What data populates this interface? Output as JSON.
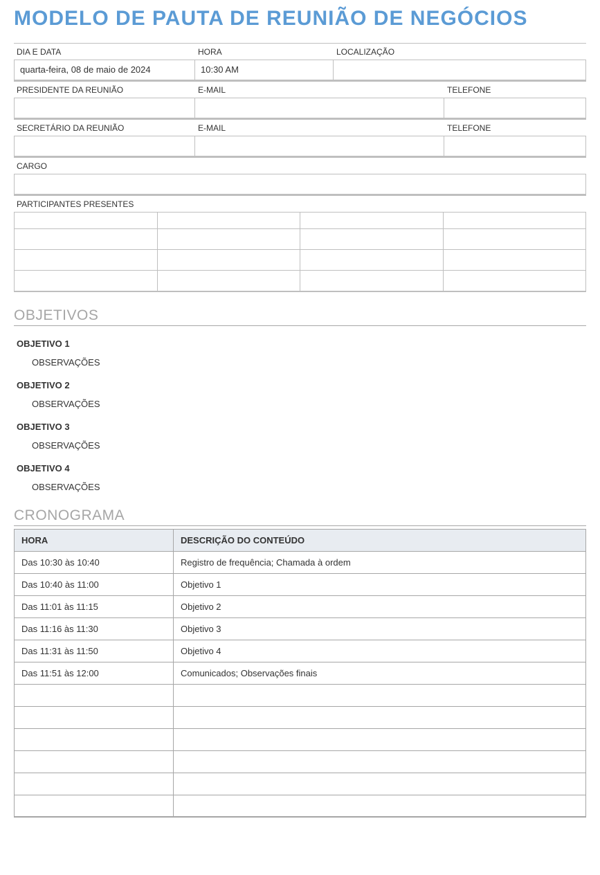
{
  "title": "MODELO DE PAUTA DE REUNIÃO DE NEGÓCIOS",
  "fields": {
    "day_date_label": "DIA E DATA",
    "time_label": "HORA",
    "location_label": "LOCALIZAÇÃO",
    "day_date_value": "quarta-feira, 08 de maio de 2024",
    "time_value": "10:30 AM",
    "location_value": "",
    "chair_label": "PRESIDENTE DA REUNIÃO",
    "email_label": "E-MAIL",
    "phone_label": "TELEFONE",
    "chair_value": "",
    "chair_email_value": "",
    "chair_phone_value": "",
    "secretary_label": "SECRETÁRIO DA REUNIÃO",
    "secretary_value": "",
    "secretary_email_value": "",
    "secretary_phone_value": "",
    "role_label": "CARGO",
    "role_value": "",
    "attendees_label": "PARTICIPANTES PRESENTES"
  },
  "sections": {
    "objectives_heading": "OBJETIVOS",
    "schedule_heading": "CRONOGRAMA"
  },
  "objectives": [
    {
      "title": "OBJETIVO 1",
      "notes_label": "OBSERVAÇÕES"
    },
    {
      "title": "OBJETIVO 2",
      "notes_label": "OBSERVAÇÕES"
    },
    {
      "title": "OBJETIVO 3",
      "notes_label": "OBSERVAÇÕES"
    },
    {
      "title": "OBJETIVO 4",
      "notes_label": "OBSERVAÇÕES"
    }
  ],
  "schedule": {
    "headers": {
      "time": "HORA",
      "desc": "DESCRIÇÃO DO CONTEÚDO"
    },
    "rows": [
      {
        "time": "Das 10:30 às 10:40",
        "desc": "Registro de frequência; Chamada à ordem"
      },
      {
        "time": "Das 10:40 às 11:00",
        "desc": "Objetivo 1"
      },
      {
        "time": "Das 11:01 às 11:15",
        "desc": "Objetivo 2"
      },
      {
        "time": "Das 11:16 às 11:30",
        "desc": "Objetivo 3"
      },
      {
        "time": "Das 11:31 às 11:50",
        "desc": "Objetivo 4"
      },
      {
        "time": "Das 11:51 às 12:00",
        "desc": "Comunicados; Observações finais"
      },
      {
        "time": "",
        "desc": ""
      },
      {
        "time": "",
        "desc": ""
      },
      {
        "time": "",
        "desc": ""
      },
      {
        "time": "",
        "desc": ""
      },
      {
        "time": "",
        "desc": ""
      },
      {
        "time": "",
        "desc": ""
      }
    ]
  }
}
